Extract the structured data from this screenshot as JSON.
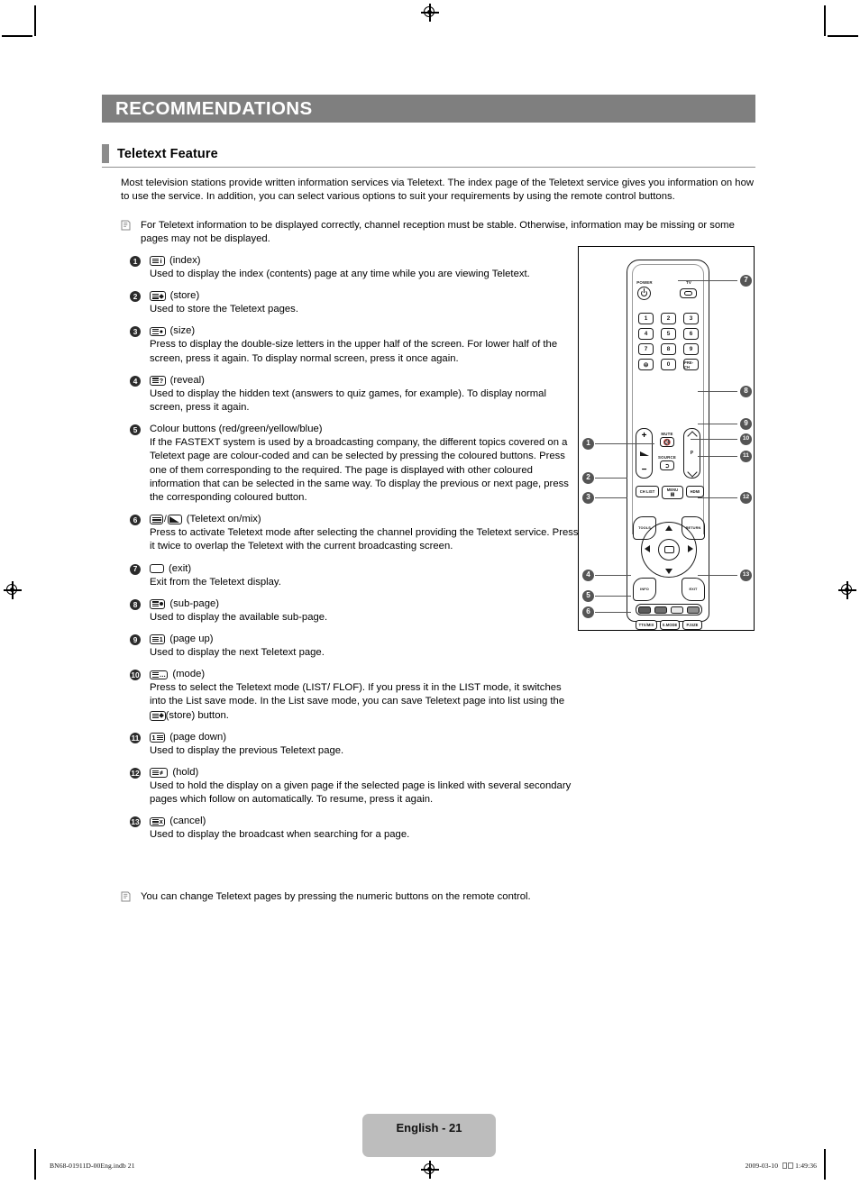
{
  "header": {
    "banner_title": "RECOMMENDATIONS",
    "section_title": "Teletext Feature"
  },
  "intro": "Most television stations provide written information services via Teletext. The index page of the Teletext service gives you information on how to use the service. In addition, you can select various options to suit your requirements by using the remote control buttons.",
  "notes": {
    "top": "For Teletext information to be displayed correctly, channel reception must be stable. Otherwise, information may be missing or some pages may not be displayed.",
    "bottom": "You can change Teletext pages by pressing the numeric buttons on the remote control."
  },
  "items": [
    {
      "num": "1",
      "label": "(index)",
      "desc": "Used to display the index (contents) page at any time while you are viewing Teletext."
    },
    {
      "num": "2",
      "label": "(store)",
      "desc": "Used to store the Teletext pages."
    },
    {
      "num": "3",
      "label": "(size)",
      "desc": "Press to display the double-size letters in the upper half of the screen. For lower half of the screen, press it again. To display normal screen, press it once again."
    },
    {
      "num": "4",
      "label": "(reveal)",
      "desc": "Used to display the hidden text (answers to quiz games, for example). To display normal screen, press it again."
    },
    {
      "num": "5",
      "label": "Colour buttons (red/green/yellow/blue)",
      "desc": "If the FASTEXT system is used by a broadcasting company, the different topics covered on a Teletext page are colour-coded and can be selected by pressing the coloured buttons. Press one of them corresponding to the required. The page is displayed with other coloured information that can be selected in the same way. To display the previous or next page, press the corresponding coloured button."
    },
    {
      "num": "6",
      "label": "(Teletext on/mix)",
      "desc": "Press to activate Teletext mode after selecting the channel providing the Teletext service. Press it twice to overlap the Teletext with the current broadcasting screen."
    },
    {
      "num": "7",
      "label": "(exit)",
      "desc": "Exit from the Teletext display."
    },
    {
      "num": "8",
      "label": "(sub-page)",
      "desc": "Used to display the available sub-page."
    },
    {
      "num": "9",
      "label": "(page up)",
      "desc": "Used to display the next Teletext page."
    },
    {
      "num": "10",
      "label": "(mode)",
      "desc_part1": "Press to select the Teletext mode (LIST/ FLOF). If you press it in the LIST mode, it switches into the List save mode. In the List save mode, you can save Teletext page into list using the ",
      "desc_part2": "(store) button."
    },
    {
      "num": "11",
      "label": "(page down)",
      "desc": "Used to display the previous Teletext page."
    },
    {
      "num": "12",
      "label": "(hold)",
      "desc": "Used to hold the display on a given page if the selected page is linked with several secondary pages which follow on automatically. To resume, press it again."
    },
    {
      "num": "13",
      "label": "(cancel)",
      "desc": "Used to display the broadcast when searching for a page."
    }
  ],
  "remote": {
    "labels": {
      "power": "POWER",
      "tv": "TV",
      "mute": "MUTE",
      "source": "SOURCE",
      "p": "P"
    },
    "numeric_keys": [
      "1",
      "2",
      "3",
      "4",
      "5",
      "6",
      "7",
      "8",
      "9",
      "0"
    ],
    "pre_ch": "PRE-CH",
    "ch_list": "CH LIST",
    "menu": "MENU",
    "hdmi": "HDMI",
    "tools": "TOOLS",
    "return": "RETURN",
    "info": "INFO",
    "exit": "EXIT",
    "bottom_keys": [
      "TTX/MIX",
      "S.MODE",
      "P.SIZE"
    ],
    "colour_buttons": [
      "#5a5a5a",
      "#707070",
      "#eaeaea",
      "#8f8f8f"
    ],
    "callouts_left": [
      "1",
      "2",
      "3",
      "4",
      "5",
      "6"
    ],
    "callouts_right": [
      "7",
      "8",
      "9",
      "10",
      "11",
      "12",
      "13"
    ]
  },
  "footer": {
    "page_label": "English - 21",
    "file_ref": "BN68-01911D-00Eng.indb   21",
    "date": "2009-03-10",
    "time": "1:49:36"
  },
  "colors": {
    "banner_bg": "#7f7f7f",
    "section_bar": "#8c8c8c",
    "page_tab_bg": "#bdbdbd",
    "callout_bg": "#555555"
  }
}
